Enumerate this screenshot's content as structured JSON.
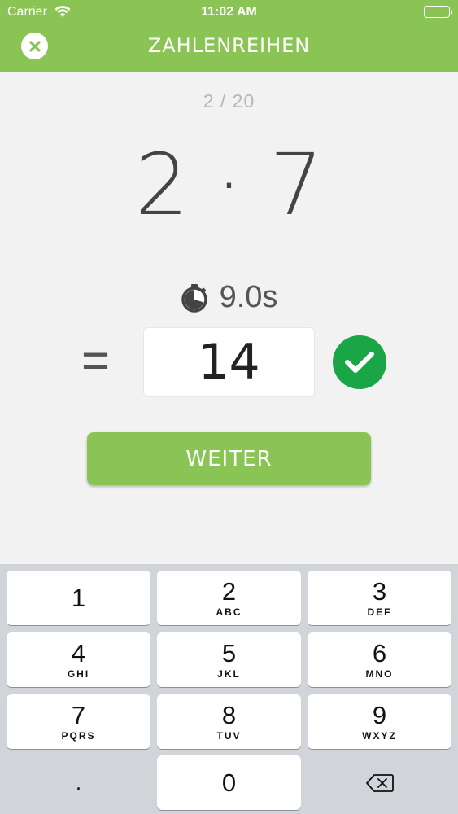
{
  "status_bar": {
    "carrier": "Carrier",
    "time": "11:02 AM"
  },
  "header": {
    "title": "ZAHLENREIHEN",
    "close_icon": "close-icon",
    "color": "#8ac455"
  },
  "exercise": {
    "progress": "2 / 20",
    "question": "2 · 7",
    "timer": "9.0s",
    "equals": "=",
    "answer": "14",
    "correct": true,
    "correct_color": "#1aa547"
  },
  "next_button": {
    "label": "WEITER"
  },
  "keyboard": {
    "keys": [
      {
        "num": "1",
        "letters": ""
      },
      {
        "num": "2",
        "letters": "ABC"
      },
      {
        "num": "3",
        "letters": "DEF"
      },
      {
        "num": "4",
        "letters": "GHI"
      },
      {
        "num": "5",
        "letters": "JKL"
      },
      {
        "num": "6",
        "letters": "MNO"
      },
      {
        "num": "7",
        "letters": "PQRS"
      },
      {
        "num": "8",
        "letters": "TUV"
      },
      {
        "num": "9",
        "letters": "WXYZ"
      },
      {
        "num": "0",
        "letters": ""
      }
    ],
    "decimal": "."
  }
}
